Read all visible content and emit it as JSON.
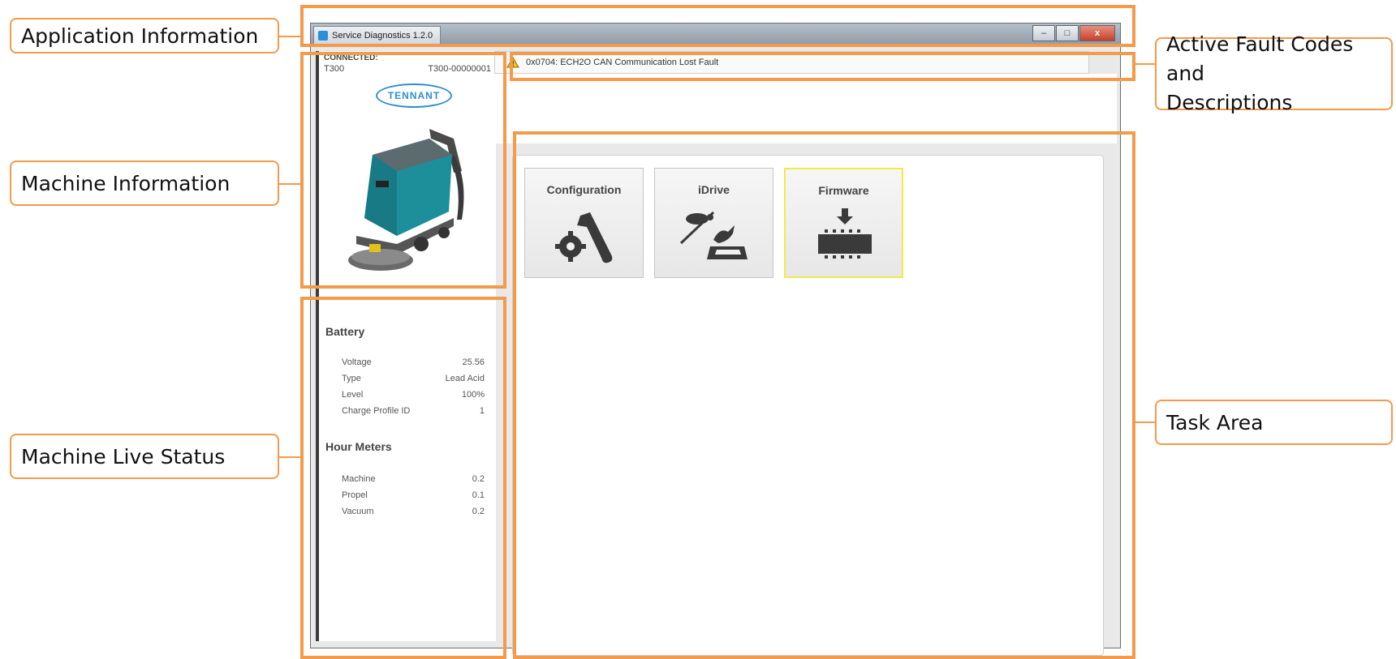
{
  "window": {
    "title": "Service Diagnostics 1.2.0",
    "minimize_glyph": "–",
    "maximize_glyph": "□",
    "close_glyph": "x"
  },
  "machine": {
    "status": "CONNECTED:",
    "model": "T300",
    "serial": "T300-00000001",
    "brand": "TENNANT"
  },
  "live_status": {
    "battery_title": "Battery",
    "battery": [
      {
        "label": "Voltage",
        "value": "25.56"
      },
      {
        "label": "Type",
        "value": "Lead Acid"
      },
      {
        "label": "Level",
        "value": "100%"
      },
      {
        "label": "Charge Profile ID",
        "value": "1"
      }
    ],
    "hours_title": "Hour Meters",
    "hours": [
      {
        "label": "Machine",
        "value": "0.2"
      },
      {
        "label": "Propel",
        "value": "0.1"
      },
      {
        "label": "Vacuum",
        "value": "0.2"
      }
    ]
  },
  "fault": {
    "text": "0x0704: ECH2O CAN Communication Lost Fault",
    "icon": "warning-icon"
  },
  "tasks": [
    {
      "label": "Configuration",
      "icon": "gear-wrench-icon"
    },
    {
      "label": "iDrive",
      "icon": "turtle-rabbit-icon"
    },
    {
      "label": "Firmware",
      "icon": "chip-download-icon",
      "selected": true
    }
  ],
  "callouts": {
    "app_info": "Application Information",
    "machine_info": "Machine Information",
    "live_status": "Machine Live Status",
    "fault_codes_line1": "Active Fault Codes and",
    "fault_codes_line2": "Descriptions",
    "task_area": "Task Area"
  },
  "colors": {
    "callout_border": "#f39a4b",
    "brand_blue": "#2f8fcf",
    "machine_teal": "#1d8f9a",
    "selected_tile": "#f3ea4a"
  }
}
